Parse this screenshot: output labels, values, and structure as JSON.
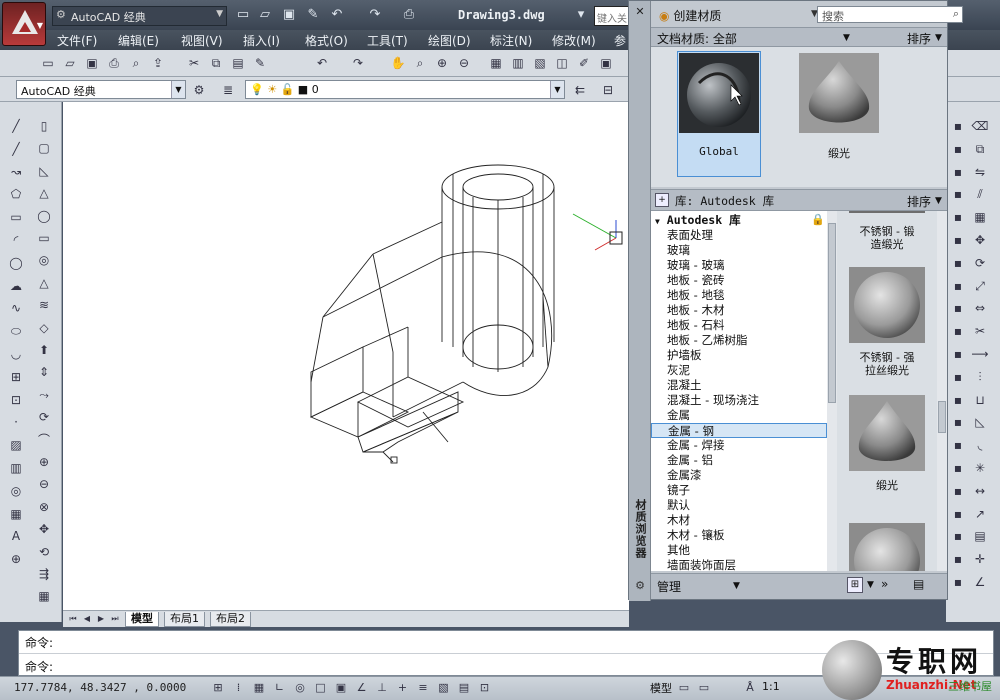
{
  "titlebar": {
    "workspace": "AutoCAD 经典",
    "document_title": "Drawing3.dwg",
    "help_search_placeholder": "键入关"
  },
  "menu": {
    "items": [
      "文件(F)",
      "编辑(E)",
      "视图(V)",
      "插入(I)",
      "格式(O)",
      "工具(T)",
      "绘图(D)",
      "标注(N)",
      "修改(M)",
      "参"
    ]
  },
  "toolbar2": {
    "style_combo": "AutoCAD 经典",
    "layer_combo": "0"
  },
  "layout_tabs": {
    "tabs": [
      "模型",
      "布局1",
      "布局2"
    ],
    "active": "模型"
  },
  "command": {
    "line1": "命令:",
    "line2": "命令:"
  },
  "statusbar": {
    "coordinates": "177.7784, 48.3427 , 0.0000",
    "model_label": "模型",
    "scale": "1:1"
  },
  "materials": {
    "palette_title": "材质浏览器",
    "create_label": "创建材质",
    "search_placeholder": "搜索",
    "doc_filter_label": "文档材质: 全部",
    "sort_label": "排序",
    "doc_swatches": [
      {
        "name": "Global",
        "selected": true
      },
      {
        "name": "缎光",
        "selected": false
      }
    ],
    "library_label": "库: Autodesk 库",
    "library_sort_label": "排序",
    "tree_root": "Autodesk 库",
    "tree_items": [
      "表面处理",
      "玻璃",
      "玻璃 - 玻璃",
      "地板 - 瓷砖",
      "地板 - 地毯",
      "地板 - 木材",
      "地板 - 石料",
      "地板 - 乙烯树脂",
      "护墙板",
      "灰泥",
      "混凝土",
      "混凝土 - 现场浇注",
      "金属",
      "金属 - 钢",
      "金属 - 焊接",
      "金属 - 铝",
      "金属漆",
      "镜子",
      "默认",
      "木材",
      "木材 - 镶板",
      "其他",
      "墙面装饰面层"
    ],
    "tree_selected": "金属 - 钢",
    "library_swatches": [
      {
        "label_line1": "不锈钢 - 锻",
        "label_line2": "造缎光"
      },
      {
        "label_line1": "不锈钢 - 强",
        "label_line2": "拉丝缎光"
      },
      {
        "label_line1": "缎光",
        "label_line2": ""
      }
    ],
    "manage_label": "管理"
  },
  "watermark": {
    "title": "专职网",
    "url": "Zhuanzhi.Net",
    "subtitle": "三维书屋"
  }
}
